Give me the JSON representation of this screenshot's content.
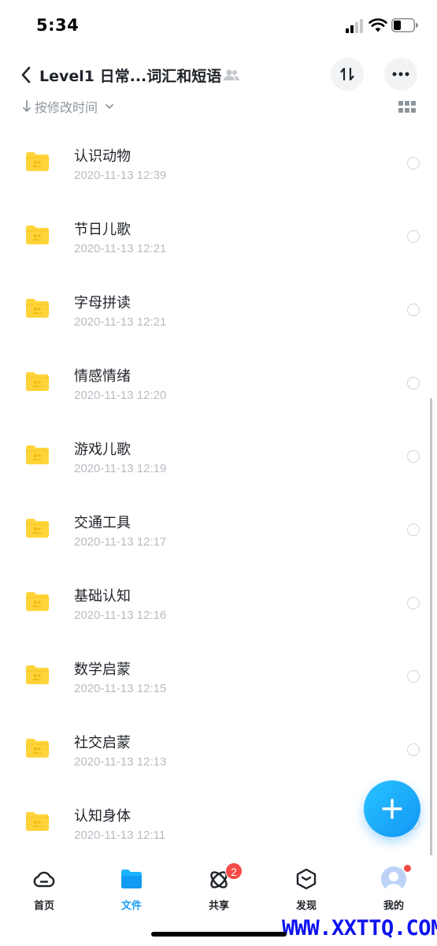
{
  "status_bar": {
    "time": "5:34"
  },
  "header": {
    "back_icon": "chevron-left-icon",
    "title": "Level1 日常...词汇和短语",
    "shared_icon": "group-icon",
    "sort_icon": "sort-icon",
    "more_icon": "more-horizontal-icon"
  },
  "sort_bar": {
    "label": "按修改时间",
    "arrow_icon": "arrow-down-icon",
    "dropdown_icon": "chevron-down-icon",
    "view_toggle_icon": "grid-view-icon"
  },
  "files": [
    {
      "name": "认识动物",
      "time": "2020-11-13 12:39"
    },
    {
      "name": "节日儿歌",
      "time": "2020-11-13 12:21"
    },
    {
      "name": "字母拼读",
      "time": "2020-11-13 12:21"
    },
    {
      "name": "情感情绪",
      "time": "2020-11-13 12:20"
    },
    {
      "name": "游戏儿歌",
      "time": "2020-11-13 12:19"
    },
    {
      "name": "交通工具",
      "time": "2020-11-13 12:17"
    },
    {
      "name": "基础认知",
      "time": "2020-11-13 12:16"
    },
    {
      "name": "数学启蒙",
      "time": "2020-11-13 12:15"
    },
    {
      "name": "社交启蒙",
      "time": "2020-11-13 12:13"
    },
    {
      "name": "认知身体",
      "time": "2020-11-13 12:11"
    }
  ],
  "fab": {
    "icon": "plus-icon"
  },
  "tabs": [
    {
      "label": "首页",
      "icon": "cloud-icon"
    },
    {
      "label": "文件",
      "icon": "folder-icon",
      "active": true
    },
    {
      "label": "共享",
      "icon": "share-orbit-icon",
      "badge": "2"
    },
    {
      "label": "发现",
      "icon": "cube-icon"
    },
    {
      "label": "我的",
      "icon": "avatar-icon"
    }
  ],
  "watermark": "WWW.XXTTQ.COM",
  "colors": {
    "accent": "#1a9df5",
    "folder": "#ffd43b",
    "badge": "#f54a45",
    "muted_text": "#b8bcc2"
  }
}
